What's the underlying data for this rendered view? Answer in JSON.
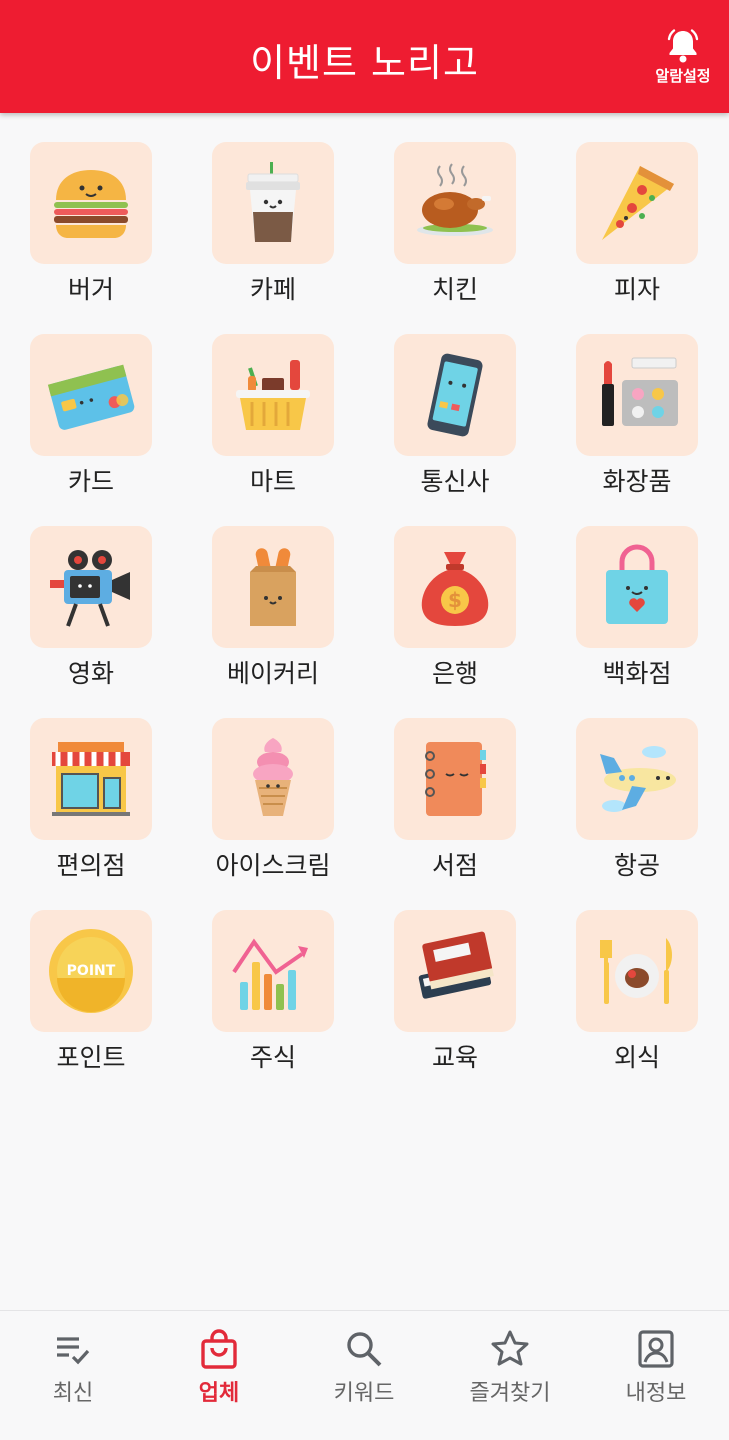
{
  "header": {
    "title": "이벤트 노리고",
    "alarm_label": "알람설정",
    "accent_color": "#ee1c31"
  },
  "categories": [
    {
      "label": "버거",
      "icon": "burger-icon"
    },
    {
      "label": "카페",
      "icon": "coffee-cup-icon"
    },
    {
      "label": "치킨",
      "icon": "roast-chicken-icon"
    },
    {
      "label": "피자",
      "icon": "pizza-slice-icon"
    },
    {
      "label": "카드",
      "icon": "credit-card-icon"
    },
    {
      "label": "마트",
      "icon": "grocery-basket-icon"
    },
    {
      "label": "통신사",
      "icon": "smartphone-icon"
    },
    {
      "label": "화장품",
      "icon": "cosmetics-icon"
    },
    {
      "label": "영화",
      "icon": "movie-camera-icon"
    },
    {
      "label": "베이커리",
      "icon": "bread-bag-icon"
    },
    {
      "label": "은행",
      "icon": "money-bag-icon"
    },
    {
      "label": "백화점",
      "icon": "shopping-bag-icon"
    },
    {
      "label": "편의점",
      "icon": "convenience-store-icon"
    },
    {
      "label": "아이스크림",
      "icon": "ice-cream-icon"
    },
    {
      "label": "서점",
      "icon": "book-icon"
    },
    {
      "label": "항공",
      "icon": "airplane-icon"
    },
    {
      "label": "포인트",
      "icon": "point-coin-icon",
      "icon_text": "POINT"
    },
    {
      "label": "주식",
      "icon": "stock-chart-icon"
    },
    {
      "label": "교육",
      "icon": "textbooks-icon"
    },
    {
      "label": "외식",
      "icon": "dining-icon"
    }
  ],
  "bottom_nav": [
    {
      "label": "최신",
      "icon": "checklist-icon",
      "active": false
    },
    {
      "label": "업체",
      "icon": "shopping-bag-icon",
      "active": true
    },
    {
      "label": "키워드",
      "icon": "search-icon",
      "active": false
    },
    {
      "label": "즐겨찾기",
      "icon": "star-icon",
      "active": false
    },
    {
      "label": "내정보",
      "icon": "profile-icon",
      "active": false
    }
  ]
}
